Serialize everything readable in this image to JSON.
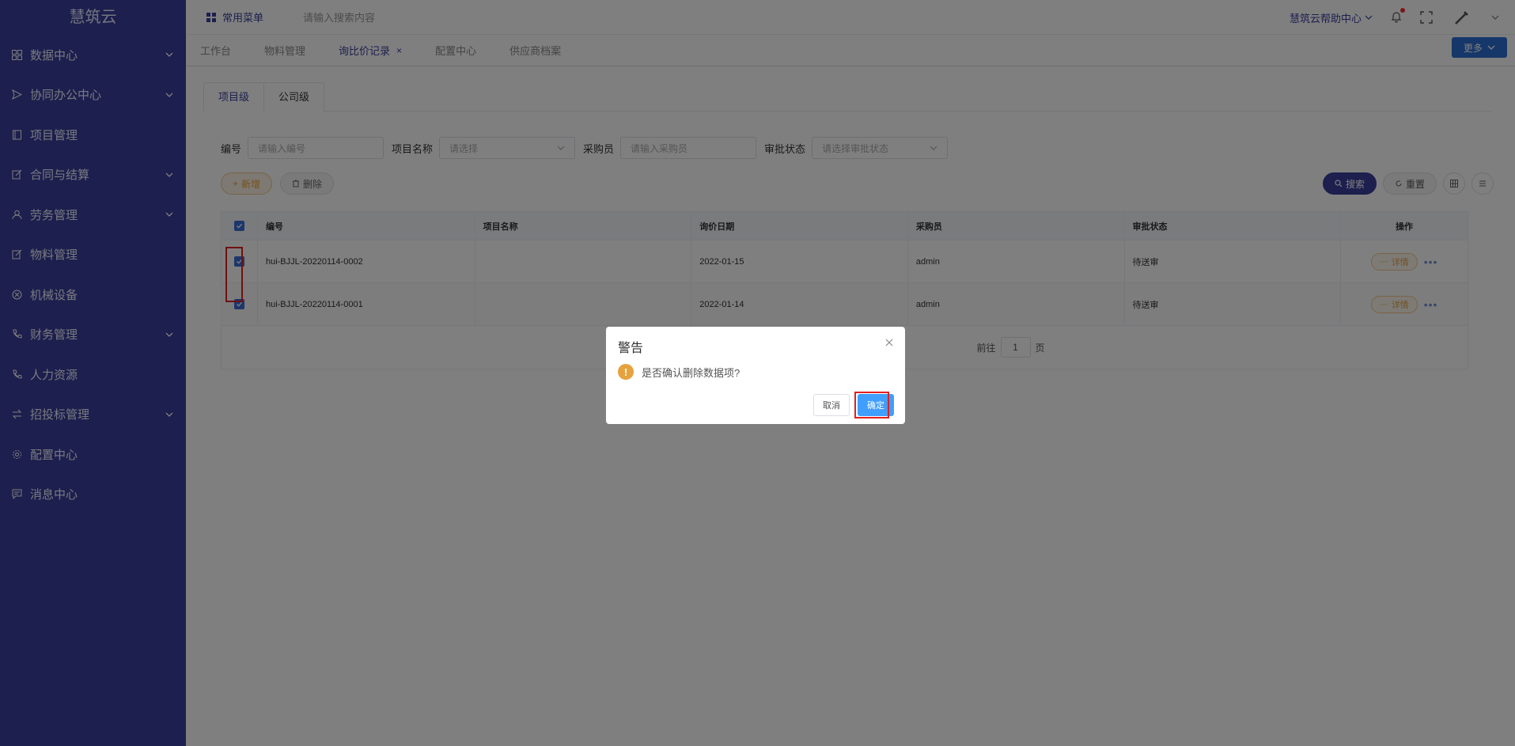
{
  "brand": "慧筑云",
  "sidebar": {
    "items": [
      {
        "label": "数据中心",
        "icon": "grid-icon",
        "expandable": true
      },
      {
        "label": "协同办公中心",
        "icon": "send-icon",
        "expandable": true
      },
      {
        "label": "项目管理",
        "icon": "book-icon",
        "expandable": false
      },
      {
        "label": "合同与结算",
        "icon": "edit-icon",
        "expandable": true
      },
      {
        "label": "劳务管理",
        "icon": "user-icon",
        "expandable": true
      },
      {
        "label": "物料管理",
        "icon": "edit-icon",
        "expandable": false
      },
      {
        "label": "机械设备",
        "icon": "circle-x-icon",
        "expandable": false
      },
      {
        "label": "财务管理",
        "icon": "phone-icon",
        "expandable": true
      },
      {
        "label": "人力资源",
        "icon": "phone-icon",
        "expandable": false
      },
      {
        "label": "招投标管理",
        "icon": "swap-icon",
        "expandable": true
      },
      {
        "label": "配置中心",
        "icon": "gear-icon",
        "expandable": false
      },
      {
        "label": "消息中心",
        "icon": "message-icon",
        "expandable": false
      }
    ]
  },
  "header": {
    "common_menu": "常用菜单",
    "search_placeholder": "请输入搜索内容",
    "help": "慧筑云帮助中心"
  },
  "tabs": [
    {
      "label": "工作台",
      "active": false
    },
    {
      "label": "物料管理",
      "active": false
    },
    {
      "label": "询比价记录",
      "active": true,
      "closable": true
    },
    {
      "label": "配置中心",
      "active": false
    },
    {
      "label": "供应商档案",
      "active": false
    }
  ],
  "more_label": "更多",
  "sub_tabs": [
    {
      "label": "项目级",
      "active": true
    },
    {
      "label": "公司级",
      "active": false
    }
  ],
  "filters": [
    {
      "label": "编号",
      "placeholder": "请输入编号",
      "select": false
    },
    {
      "label": "项目名称",
      "placeholder": "请选择",
      "select": true
    },
    {
      "label": "采购员",
      "placeholder": "请输入采购员",
      "select": false
    },
    {
      "label": "审批状态",
      "placeholder": "请选择审批状态",
      "select": true
    }
  ],
  "actions": {
    "add": "新增",
    "delete": "删除",
    "search": "搜索",
    "reset": "重置"
  },
  "table": {
    "columns": [
      "编号",
      "项目名称",
      "询价日期",
      "采购员",
      "审批状态",
      "操作"
    ],
    "rows": [
      {
        "code": "hui-BJJL-20220114-0002",
        "project": "",
        "date": "2022-01-15",
        "buyer": "admin",
        "status": "待送审",
        "detail": "详情"
      },
      {
        "code": "hui-BJJL-20220114-0001",
        "project": "",
        "date": "2022-01-14",
        "buyer": "admin",
        "status": "待送审",
        "detail": "详情"
      }
    ]
  },
  "pager": {
    "goto": "前往",
    "page": "1",
    "unit": "页"
  },
  "dialog": {
    "title": "警告",
    "message": "是否确认删除数据项?",
    "cancel": "取消",
    "confirm": "确定"
  },
  "colors": {
    "sidebar": "#3a3f9d",
    "primary": "#409eff",
    "warning": "#e6a23c",
    "highlight": "#e02020"
  }
}
